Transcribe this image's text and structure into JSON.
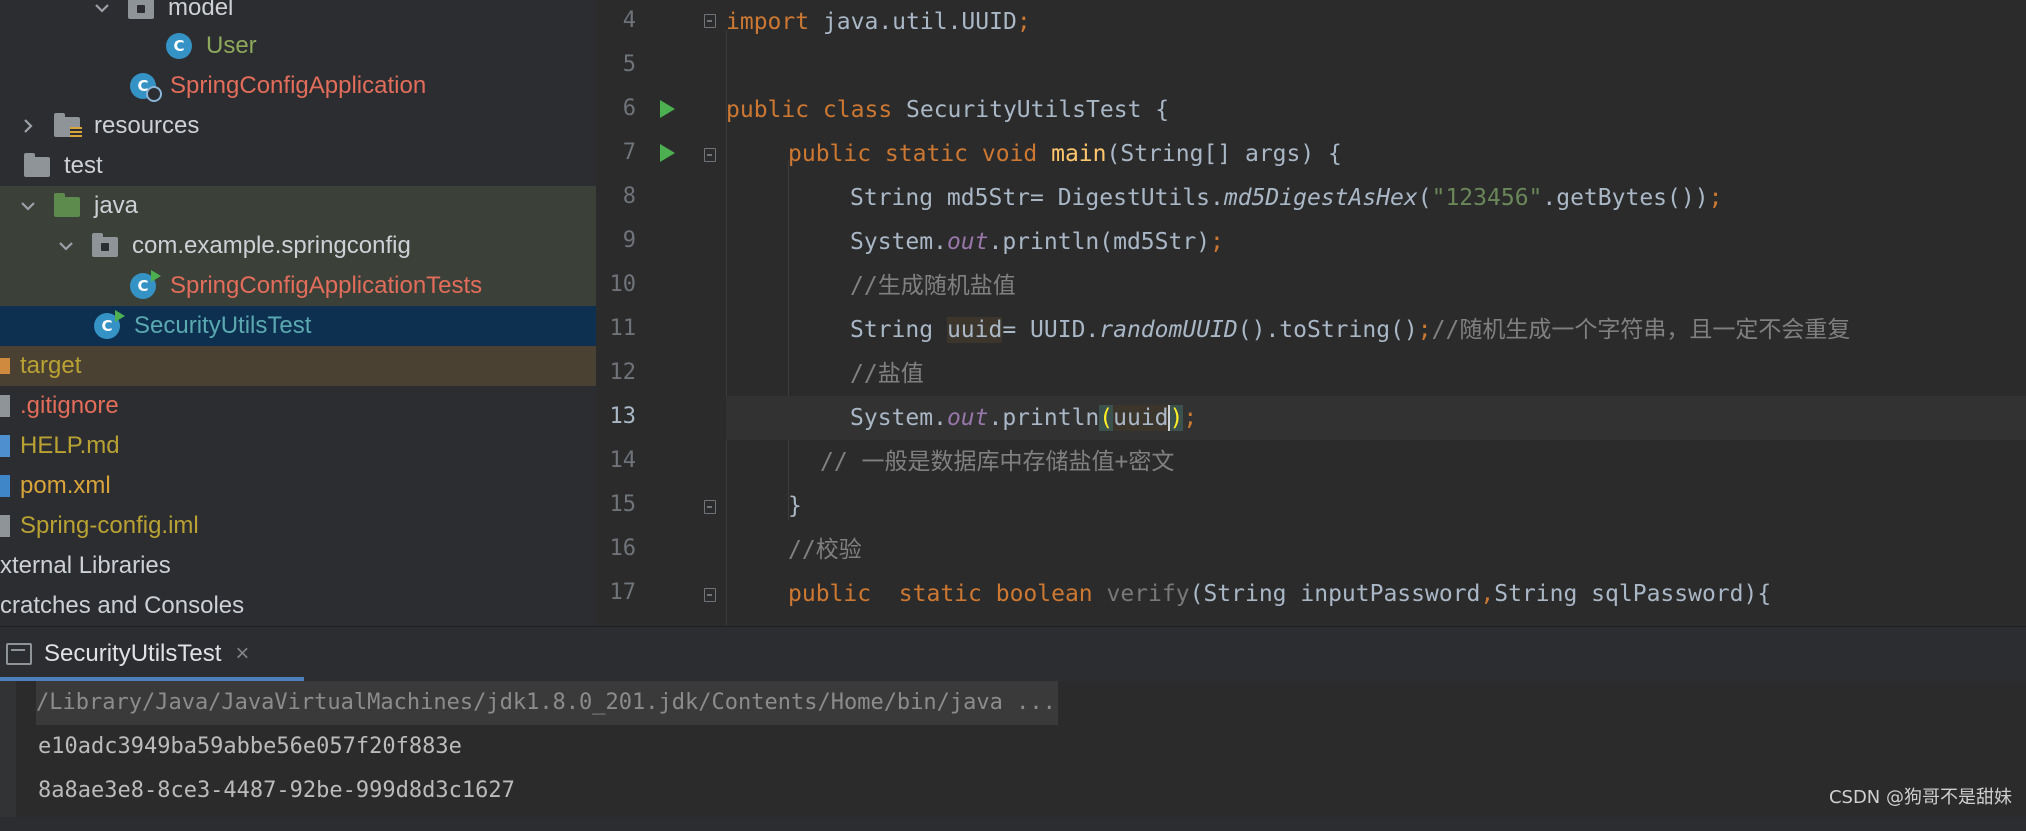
{
  "project_tree": {
    "items": [
      {
        "label": "model",
        "kind": "package",
        "color": "default"
      },
      {
        "label": "User",
        "kind": "class",
        "color": "green"
      },
      {
        "label": "SpringConfigApplication",
        "kind": "boot-class",
        "color": "red"
      },
      {
        "label": "resources",
        "kind": "resources-folder",
        "color": "default"
      },
      {
        "label": "test",
        "kind": "folder",
        "color": "default"
      },
      {
        "label": "java",
        "kind": "test-folder",
        "color": "default"
      },
      {
        "label": "com.example.springconfig",
        "kind": "package",
        "color": "default"
      },
      {
        "label": "SpringConfigApplicationTests",
        "kind": "runnable-class",
        "color": "red"
      },
      {
        "label": "SecurityUtilsTest",
        "kind": "runnable-class",
        "color": "teal"
      },
      {
        "label": "target",
        "kind": "excluded-folder",
        "color": "yellow"
      },
      {
        "label": ".gitignore",
        "kind": "file",
        "color": "red"
      },
      {
        "label": "HELP.md",
        "kind": "file",
        "color": "yellow"
      },
      {
        "label": "pom.xml",
        "kind": "maven-file",
        "color": "orange"
      },
      {
        "label": "Spring-config.iml",
        "kind": "file",
        "color": "yellow"
      },
      {
        "label": "xternal Libraries",
        "kind": "node",
        "color": "default"
      },
      {
        "label": "cratches and Consoles",
        "kind": "node",
        "color": "default"
      }
    ]
  },
  "editor": {
    "line_numbers": [
      "4",
      "5",
      "6",
      "7",
      "8",
      "9",
      "10",
      "11",
      "12",
      "13",
      "14",
      "15",
      "16",
      "17"
    ],
    "current_line": "13",
    "code": {
      "l4": {
        "kw": "import",
        "rest": " java.util.UUID",
        "semi": ";"
      },
      "l6": {
        "kw": "public class",
        "rest": " SecurityUtilsTest {"
      },
      "l7": {
        "kw": "public static void",
        "fn": "main",
        "rest": "(String[] args) {"
      },
      "l8": {
        "a": "String md5Str= DigestUtils.",
        "method": "md5DigestAsHex",
        "b": "(",
        "str": "\"123456\"",
        "c": ".getBytes())",
        "semi": ";"
      },
      "l9": {
        "a": "System.",
        "field": "out",
        "b": ".println(md5Str)",
        "semi": ";"
      },
      "l10": {
        "comment": "//生成随机盐值"
      },
      "l11": {
        "a": "String ",
        "var": "uuid",
        "b": "= UUID.",
        "method": "randomUUID",
        "c": "().toString()",
        "semi": ";",
        "comment": "//随机生成一个字符串，且一定不会重复"
      },
      "l12": {
        "comment": "//盐值"
      },
      "l13": {
        "a": "System.",
        "field": "out",
        "b": ".println",
        "open": "(",
        "var1": "uuid",
        "close": ")",
        "semi": ";"
      },
      "l14": {
        "comment": "// 一般是数据库中存储盐值+密文"
      },
      "l15": {
        "a": "}"
      },
      "l16": {
        "comment": "//校验"
      },
      "l17": {
        "kw1": "public",
        "kw2": "  static boolean",
        "unused": " verify",
        "b": "(String inputPassword",
        "comma": ",",
        "c": "String sqlPassword){"
      }
    }
  },
  "run_panel": {
    "tab_label": "SecurityUtilsTest",
    "close_glyph": "×",
    "output": [
      "/Library/Java/JavaVirtualMachines/jdk1.8.0_201.jdk/Contents/Home/bin/java ...",
      "e10adc3949ba59abbe56e057f20f883e",
      "8a8ae3e8-8ce3-4487-92be-999d8d3c1627"
    ]
  },
  "watermark": "CSDN @狗哥不是甜妹"
}
